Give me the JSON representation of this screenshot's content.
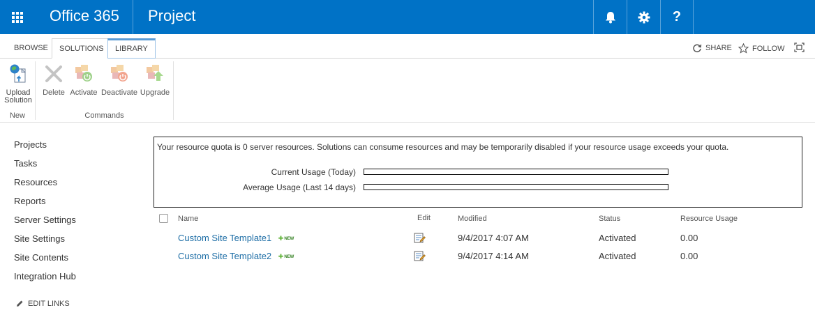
{
  "suitebar": {
    "brand": "Office 365",
    "app_name": "Project",
    "help_glyph": "?",
    "icons": [
      "app-launcher-icon",
      "bell-icon",
      "gear-icon",
      "help-icon"
    ],
    "color": "#0072c6"
  },
  "ribbon": {
    "tabs": [
      {
        "label": "BROWSE"
      },
      {
        "label": "SOLUTIONS"
      },
      {
        "label": "LIBRARY"
      }
    ],
    "actions": {
      "share": "SHARE",
      "follow": "FOLLOW"
    },
    "groups": [
      {
        "label": "New",
        "buttons": [
          {
            "label_line1": "Upload",
            "label_line2": "Solution",
            "icon": "upload-solution-icon"
          }
        ]
      },
      {
        "label": "Commands",
        "buttons": [
          {
            "label": "Delete",
            "icon": "delete-icon"
          },
          {
            "label": "Activate",
            "icon": "activate-icon"
          },
          {
            "label": "Deactivate",
            "icon": "deactivate-icon"
          },
          {
            "label": "Upgrade",
            "icon": "upgrade-icon"
          }
        ]
      }
    ]
  },
  "leftnav": {
    "items": [
      "Projects",
      "Tasks",
      "Resources",
      "Reports",
      "Server Settings",
      "Site Settings",
      "Site Contents",
      "Integration Hub"
    ],
    "edit_links": "EDIT LINKS"
  },
  "quota": {
    "message": "Your resource quota is 0 server resources. Solutions can consume resources and may be temporarily disabled if your resource usage exceeds your quota.",
    "current_label": "Current Usage (Today)",
    "current_fraction": 0,
    "average_label": "Average Usage (Last 14 days)",
    "average_fraction": 0
  },
  "list": {
    "columns": {
      "name": "Name",
      "edit": "Edit",
      "modified": "Modified",
      "status": "Status",
      "resource_usage": "Resource Usage"
    },
    "new_badge": "NEW",
    "rows": [
      {
        "name": "Custom Site Template1",
        "modified": "9/4/2017 4:07 AM",
        "status": "Activated",
        "resource_usage": "0.00"
      },
      {
        "name": "Custom Site Template2",
        "modified": "9/4/2017 4:14 AM",
        "status": "Activated",
        "resource_usage": "0.00"
      }
    ]
  }
}
